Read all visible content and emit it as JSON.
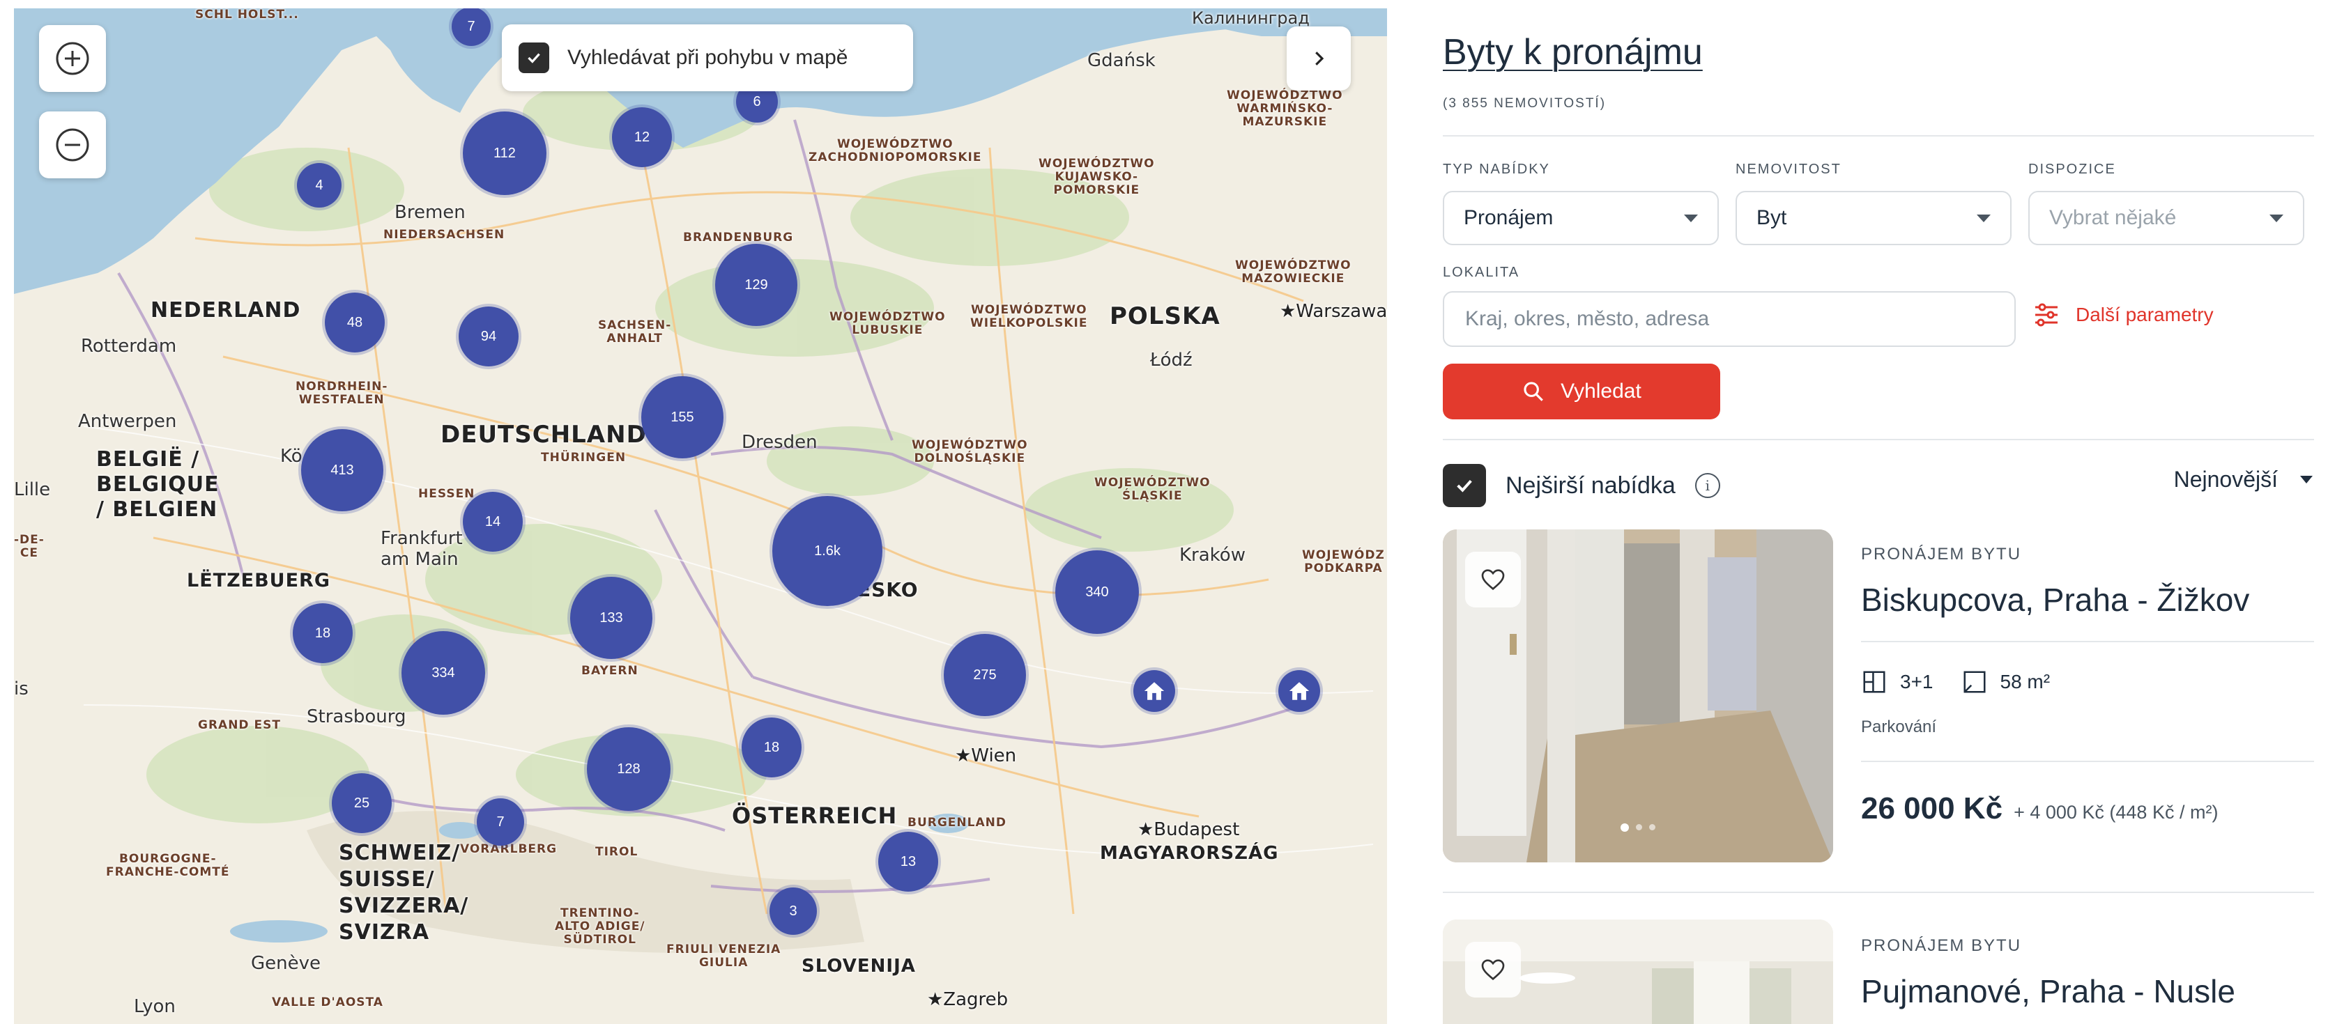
{
  "map": {
    "search_on_move_label": "Vyhledávat při pohybu v mapě",
    "search_on_move_checked": true,
    "zoom_in_icon": "plus-icon",
    "zoom_out_icon": "minus-icon",
    "collapse_icon": "chevron-right-icon",
    "countries": [
      "NEDERLAND",
      "BELGIË /",
      "BELGIQUE",
      "/ BELGIEN",
      "DEUTSCHLAND",
      "LËTZEBUERG",
      "POLSKA",
      "ESKO",
      "ÖSTERREICH",
      "SCHWEIZ/",
      "SUISSE/",
      "SVIZZERA/",
      "SVIZRA",
      "MAGYARORSZÁG",
      "SLOVENIJA"
    ],
    "regions": {
      "niedersachsen": "NIEDERSACHSEN",
      "brandenburg": "BRANDENBURG",
      "sachsen_anhalt": "SACHSEN-\nANHALT",
      "nrw": "NORDRHEIN-\nWESTFALEN",
      "hessen": "HESSEN",
      "thueringen": "THÜRINGEN",
      "bayern": "BAYERN",
      "grand_est": "GRAND EST",
      "bourgogne": "BOURGOGNE-\nFRANCHE-COMTÉ",
      "vorarlberg": "VORARLBERG",
      "tirol": "TIROL",
      "trentino": "TRENTINO-\nALTO ADIGE/\nSÜDTIROL",
      "friuli": "FRIULI VENEZIA\nGIULIA",
      "burgenland": "BURGENLAND",
      "valle_aosta": "VALLE D'AOSTA",
      "zachodniopomorskie": "WOJEWÓDZTWO\nZACHODNIOPOMORSKIE",
      "kujawsko": "WOJEWÓDZTWO\nKUJAWSKO-\nPOMORSKIE",
      "warminsko": "WOJEWÓDZTWO\nWARMIŃSKO-\nMAZURSKIE",
      "mazowieckie": "WOJEWÓDZTWO\nMAZOWIECKIE",
      "lubuskie": "WOJEWÓDZTWO\nLUBUSKIE",
      "wielkopolskie": "WOJEWÓDZTWO\nWIELKOPOLSKIE",
      "dolnoslaskie": "WOJEWÓDZTWO\nDOLNOŚLĄSKIE",
      "slaskie": "WOJEWÓDZTWO\nŚLĄSKIE",
      "podkarpackie": "WOJEWÓDZ\nPODKARPA",
      "schleswig": "SCHL\nHOLST..."
    },
    "cities": {
      "kaliningrad": "Калининград",
      "gdansk": "Gdańsk",
      "bremen": "Bremen",
      "rotterdam": "Rotterdam",
      "warszawa": "★Warszawa",
      "lodz": "Łódź",
      "antwerpen": "Antwerpen",
      "koln": "Kö",
      "dresden": "Dresden",
      "lille": "Lille",
      "de_ce": "-DE-\nCE",
      "frankfurt": "Frankfurt\nam Main",
      "krakow": "Kraków",
      "strasbourg": "Strasbourg",
      "is": "is",
      "wien": "★Wien",
      "budapest": "★Budapest",
      "geneve": "Genève",
      "lyon": "Lyon",
      "zagreb": "★Zagreb"
    },
    "clusters": [
      "7",
      "6",
      "112",
      "12",
      "4",
      "129",
      "48",
      "94",
      "155",
      "413",
      "14",
      "1.6k",
      "340",
      "133",
      "18",
      "334",
      "275",
      "18",
      "128",
      "25",
      "7",
      "13",
      "3"
    ],
    "pin_icon": "home-icon"
  },
  "panel": {
    "title": "Byty k pronájmu",
    "count": "(3 855 NEMOVITOSTÍ)",
    "filters": {
      "offer_type": {
        "label": "TYP NABÍDKY",
        "value": "Pronájem"
      },
      "property": {
        "label": "NEMOVITOST",
        "value": "Byt"
      },
      "layout": {
        "label": "DISPOZICE",
        "placeholder": "Vybrat nějaké"
      },
      "location": {
        "label": "LOKALITA",
        "placeholder": "Kraj, okres, město, adresa"
      },
      "more_params": "Další parametry",
      "search_button": "Vyhledat"
    },
    "widest_offer": {
      "label": "Nejširší nabídka",
      "checked": true
    },
    "sort": {
      "value": "Nejnovější"
    },
    "listings": [
      {
        "type": "PRONÁJEM BYTU",
        "title": "Biskupcova, Praha - Žižkov",
        "layout": "3+1",
        "area": "58 m²",
        "tag": "Parkování",
        "price": "26 000 Kč",
        "extra": "+ 4 000 Kč  (448 Kč / m²)"
      },
      {
        "type": "PRONÁJEM BYTU",
        "title": "Pujmanové, Praha - Nusle"
      }
    ]
  },
  "colors": {
    "cluster": "#4150a8",
    "accent": "#e33a2d",
    "text": "#1f2d3d"
  }
}
